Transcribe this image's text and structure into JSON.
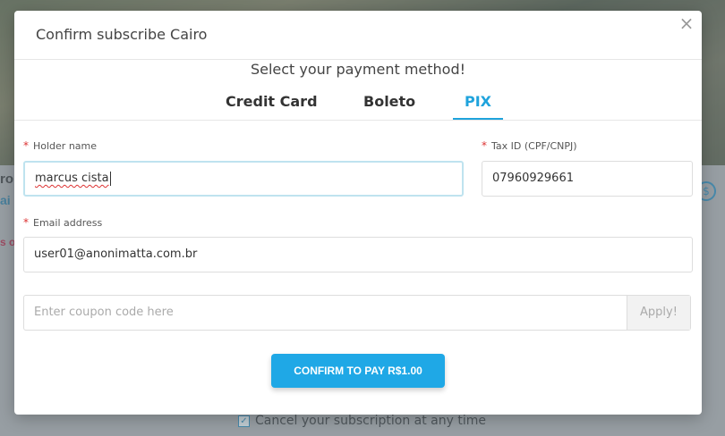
{
  "background": {
    "frag_1": "ro",
    "frag_2": "ai",
    "frag_3": "s o",
    "dollar_icon": "dollar-circle-icon",
    "cancel_check": "✓",
    "cancel_text": "Cancel your subscription at any time"
  },
  "modal": {
    "title": "Confirm subscribe Cairo",
    "close_label": "×",
    "payment_heading": "Select your payment method!",
    "tabs": {
      "credit": "Credit Card",
      "boleto": "Boleto",
      "pix": "PIX"
    },
    "active_tab": "PIX",
    "accent_color": "#1fa3dc",
    "form": {
      "required_mark": "*",
      "holder_label": "Holder name",
      "holder_value": "marcus cista",
      "tax_label": "Tax ID (CPF/CNPJ)",
      "tax_value": "07960929661",
      "email_label": "Email address",
      "email_value": "user01@anonimatta.com.br",
      "coupon_placeholder": "Enter coupon code here",
      "apply_label": "Apply!",
      "confirm_label": "CONFIRM TO PAY R$1.00"
    }
  }
}
